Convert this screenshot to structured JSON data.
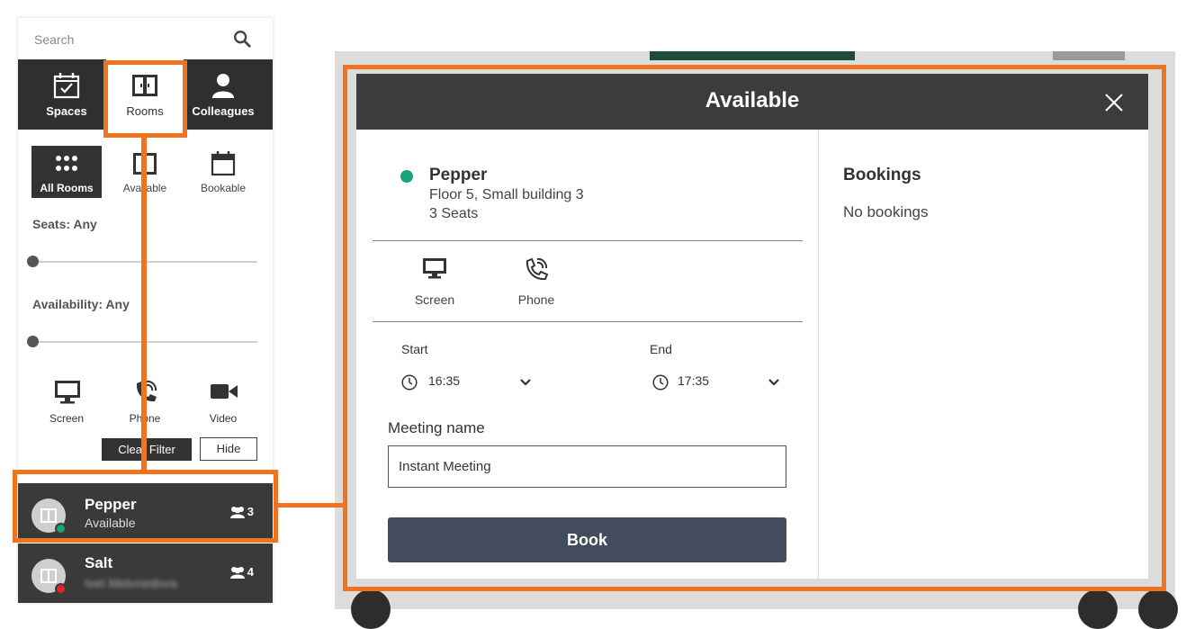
{
  "search": {
    "placeholder": "Search"
  },
  "tabs": [
    {
      "label": "Spaces",
      "icon": "calendar-check-icon"
    },
    {
      "label": "Rooms",
      "icon": "door-icon"
    },
    {
      "label": "Colleagues",
      "icon": "person-icon"
    }
  ],
  "subtabs": [
    {
      "label": "All Rooms",
      "icon": "grid-dots-icon"
    },
    {
      "label": "Available",
      "icon": "door-icon"
    },
    {
      "label": "Bookable",
      "icon": "calendar-icon"
    }
  ],
  "filters": {
    "seats_label": "Seats: Any",
    "availability_label": "Availability: Any",
    "features": [
      {
        "label": "Screen",
        "icon": "monitor-icon"
      },
      {
        "label": "Phone",
        "icon": "phone-icon"
      },
      {
        "label": "Video",
        "icon": "video-camera-icon"
      }
    ],
    "clear_label": "Clear Filter",
    "hide_label": "Hide"
  },
  "rooms": [
    {
      "name": "Pepper",
      "status": "Available",
      "seats": "3",
      "status_color": "#1aa37a"
    },
    {
      "name": "Salt",
      "status": "Ivet Metvnedova",
      "seats": "4",
      "status_color": "#e0222a"
    }
  ],
  "modal": {
    "title": "Available",
    "room_name": "Pepper",
    "room_location": "Floor 5, Small building 3",
    "room_seats": "3 Seats",
    "features": [
      {
        "label": "Screen",
        "icon": "monitor-icon"
      },
      {
        "label": "Phone",
        "icon": "phone-icon"
      }
    ],
    "start_label": "Start",
    "start_time": "16:35",
    "end_label": "End",
    "end_time": "17:35",
    "meeting_name_label": "Meeting name",
    "meeting_name_value": "Instant Meeting",
    "book_label": "Book",
    "bookings_title": "Bookings",
    "bookings_empty": "No bookings"
  },
  "colors": {
    "highlight": "#f07320",
    "available": "#1aa37a",
    "busy": "#e0222a",
    "dark": "#3c3c3c"
  }
}
